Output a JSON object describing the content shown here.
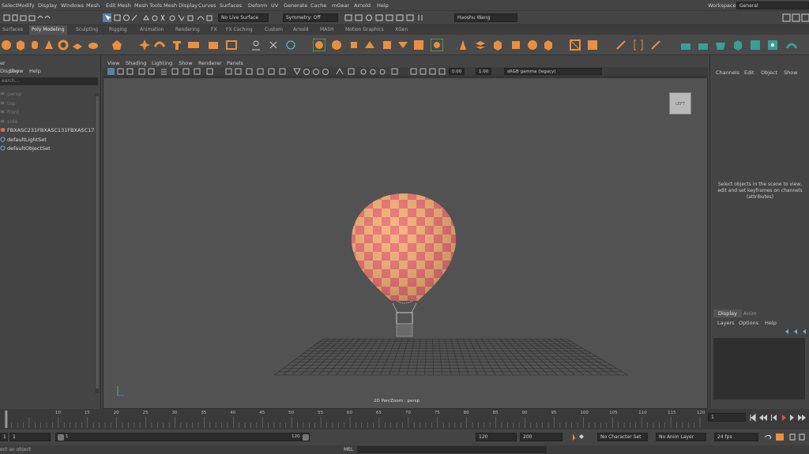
{
  "menus": [
    "Select",
    "Modify",
    "Display",
    "Windows",
    "Mesh",
    "Edit Mesh",
    "Mesh Tools",
    "Mesh Display",
    "Curves",
    "Surfaces",
    "Deform",
    "UV",
    "Generate",
    "Cache",
    "mGear",
    "Arnold",
    "Help"
  ],
  "workspace": {
    "label": "Workspace:",
    "value": "General"
  },
  "status": {
    "live_surface": "No Live Surface",
    "symmetry": "Symmetry: Off",
    "user": "Haoshu Wang"
  },
  "shelf_tabs": [
    "Surfaces",
    "Poly Modeling",
    "Sculpting",
    "Rigging",
    "Animation",
    "Rendering",
    "FX",
    "FX Caching",
    "Custom",
    "Arnold",
    "MASH",
    "Motion Graphics",
    "XGen"
  ],
  "shelf_active": "Poly Modeling",
  "outliner": {
    "title": "er",
    "menu": [
      "Display",
      "Show",
      "Help"
    ],
    "search_placeholder": "earch...",
    "items": [
      {
        "label": "persp",
        "dim": true
      },
      {
        "label": "top",
        "dim": true
      },
      {
        "label": "front",
        "dim": true
      },
      {
        "label": "side",
        "dim": true
      },
      {
        "label": "FBXASC231FBXASC131FBXASC173FBX",
        "dim": false
      },
      {
        "label": "defaultLightSet",
        "dim": false
      },
      {
        "label": "defaultObjectSet",
        "dim": false
      }
    ]
  },
  "viewport": {
    "menu": [
      "View",
      "Shading",
      "Lighting",
      "Show",
      "Renderer",
      "Panels"
    ],
    "near_value": "0.00",
    "far_value": "1.00",
    "color_space": "sRGB gamma (legacy)",
    "viewcube_label": "LEFT",
    "hud": "2D Pan/Zoom : persp",
    "balloon_colors": {
      "light": "#f5b06e",
      "dark": "#ee6d70"
    }
  },
  "channel_box": {
    "menu": [
      "Channels",
      "Edit",
      "Object",
      "Show"
    ],
    "message_lines": [
      "Select objects in the scene to view,",
      "edit and set keyframes on channels",
      "(attributes)"
    ]
  },
  "layers": {
    "tabs": [
      "Display",
      "Anim"
    ],
    "menu": [
      "Layers",
      "Options",
      "Help"
    ]
  },
  "timeline": {
    "ticks": [
      "10",
      "15",
      "20",
      "25",
      "30",
      "35",
      "40",
      "45",
      "50",
      "55",
      "60",
      "65",
      "70",
      "75",
      "80",
      "85",
      "90",
      "95",
      "100",
      "105",
      "110",
      "115",
      "120"
    ],
    "current_frame": "1"
  },
  "range": {
    "start": "1",
    "inner_start": "1",
    "slider_start": "1",
    "slider_end": "120",
    "anim_end": "120",
    "max_end": "200",
    "char_set": "No Character Set",
    "anim_layer": "No Anim Layer",
    "fps": "24 fps"
  },
  "cmd": {
    "label": "MEL",
    "status": "ect an object"
  }
}
